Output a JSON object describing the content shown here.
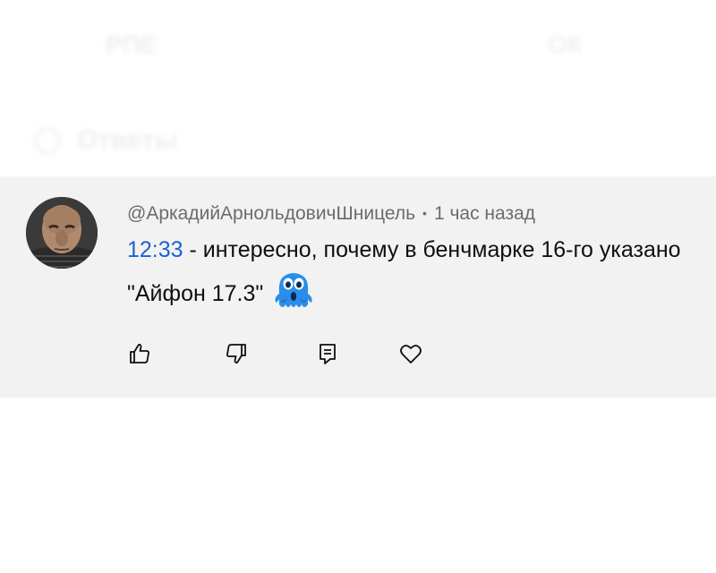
{
  "ghost": {
    "left_text": "РПЕ",
    "right_text": "ОК",
    "reply_label": "Ответы"
  },
  "comment": {
    "author": "@АркадийАрнольдовичШницель",
    "separator": "•",
    "time_ago": "1 час назад",
    "timestamp_link": "12:33",
    "text_part1": " - интересно, почему в бенчмарке 16-го указано \"Айфон 17.3\"",
    "emoji": "shocked-ghost-emoji"
  },
  "actions": [
    {
      "name": "like",
      "icon": "thumbs-up-icon"
    },
    {
      "name": "dislike",
      "icon": "thumbs-down-icon"
    },
    {
      "name": "reply",
      "icon": "reply-comment-icon"
    },
    {
      "name": "favorite",
      "icon": "heart-icon"
    }
  ],
  "colors": {
    "card_background": "#f2f2f2",
    "link": "#1a63d2",
    "meta_text": "#6c6c6c",
    "body_text": "#0f0f0f",
    "emoji_blue": "#2a8ee8"
  }
}
